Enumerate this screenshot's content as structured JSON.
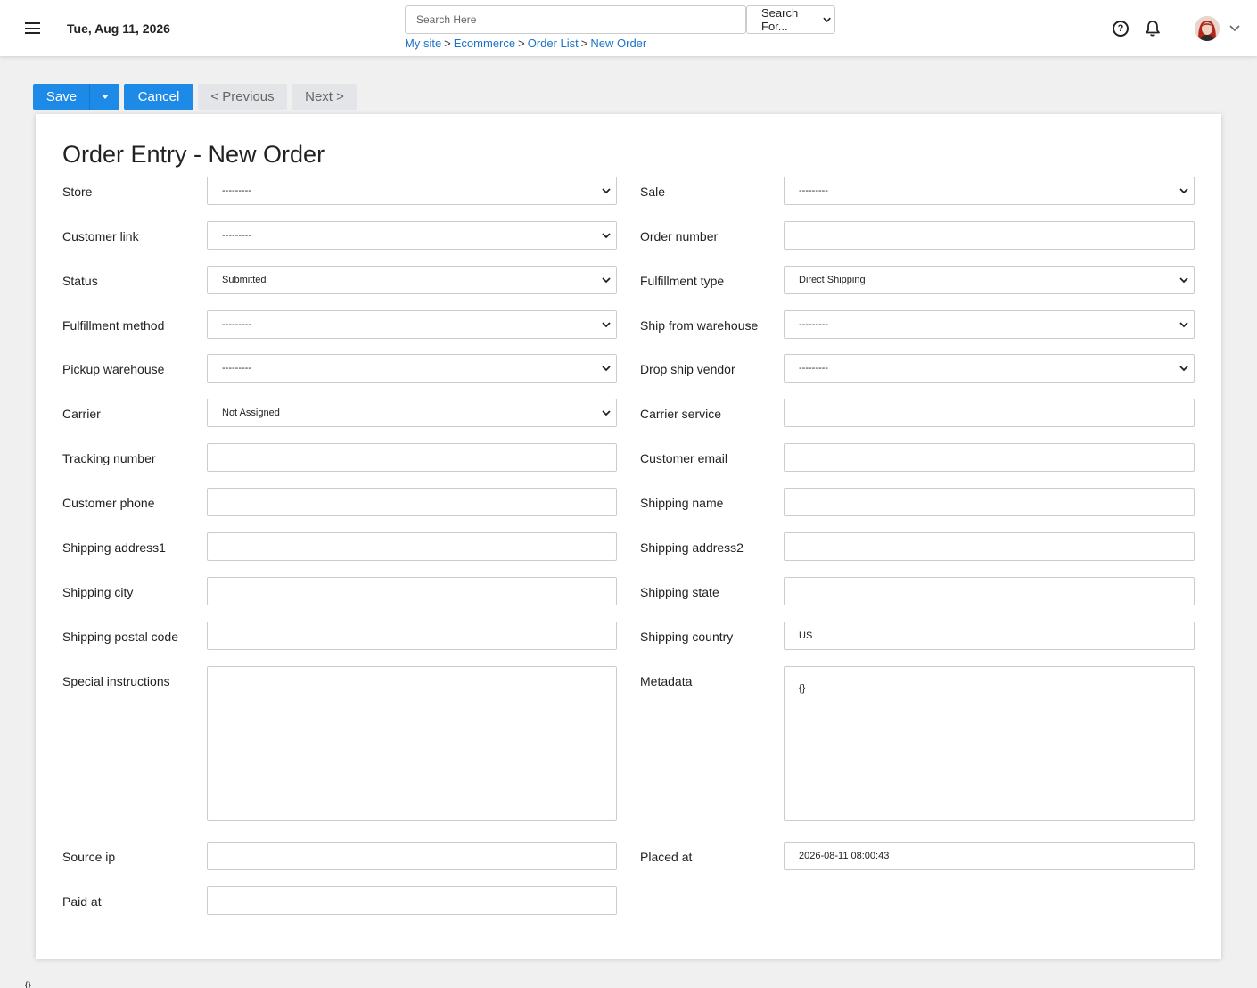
{
  "header": {
    "date": "Tue, Aug 11, 2026",
    "search_placeholder": "Search Here",
    "search_scope": "Search For...",
    "breadcrumb": [
      "My site",
      "Ecommerce",
      "Order List",
      "New Order"
    ],
    "breadcrumb_sep": ">"
  },
  "toolbar": {
    "save": "Save",
    "cancel": "Cancel",
    "previous": "< Previous",
    "next": "Next >"
  },
  "form": {
    "title": "Order Entry - New Order",
    "fields": {
      "store": {
        "label": "Store",
        "value": "---------"
      },
      "sale": {
        "label": "Sale",
        "value": "---------"
      },
      "customer_link": {
        "label": "Customer link",
        "value": "---------"
      },
      "order_number": {
        "label": "Order number",
        "value": ""
      },
      "status": {
        "label": "Status",
        "value": "Submitted"
      },
      "fulfillment_type": {
        "label": "Fulfillment type",
        "value": "Direct Shipping"
      },
      "fulfillment_method": {
        "label": "Fulfillment method",
        "value": "---------"
      },
      "ship_from_warehouse": {
        "label": "Ship from warehouse",
        "value": "---------"
      },
      "pickup_warehouse": {
        "label": "Pickup warehouse",
        "value": "---------"
      },
      "drop_ship_vendor": {
        "label": "Drop ship vendor",
        "value": "---------"
      },
      "carrier": {
        "label": "Carrier",
        "value": "Not Assigned"
      },
      "carrier_service": {
        "label": "Carrier service",
        "value": ""
      },
      "tracking_number": {
        "label": "Tracking number",
        "value": ""
      },
      "customer_email": {
        "label": "Customer email",
        "value": ""
      },
      "customer_phone": {
        "label": "Customer phone",
        "value": ""
      },
      "shipping_name": {
        "label": "Shipping name",
        "value": ""
      },
      "shipping_address1": {
        "label": "Shipping address1",
        "value": ""
      },
      "shipping_address2": {
        "label": "Shipping address2",
        "value": ""
      },
      "shipping_city": {
        "label": "Shipping city",
        "value": ""
      },
      "shipping_state": {
        "label": "Shipping state",
        "value": ""
      },
      "shipping_postal_code": {
        "label": "Shipping postal code",
        "value": ""
      },
      "shipping_country": {
        "label": "Shipping country",
        "value": "US"
      },
      "special_instructions": {
        "label": "Special instructions",
        "value": ""
      },
      "metadata": {
        "label": "Metadata",
        "value": "{}"
      },
      "source_ip": {
        "label": "Source ip",
        "value": ""
      },
      "placed_at": {
        "label": "Placed at",
        "value": "2026-08-11 08:00:43"
      },
      "paid_at": {
        "label": "Paid at",
        "value": ""
      }
    }
  },
  "footer": {
    "mark": "{}"
  },
  "colors": {
    "primary": "#1c8ae6",
    "link": "#1a73c8",
    "background": "#f0f0f0"
  }
}
